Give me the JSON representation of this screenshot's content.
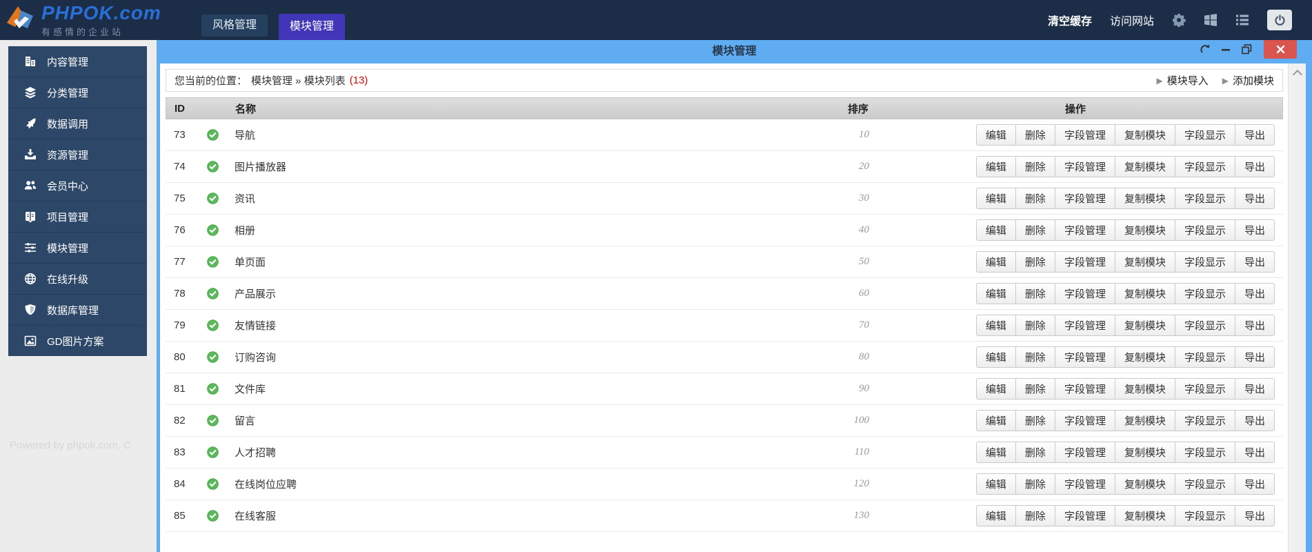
{
  "colors": {
    "header_bg": "#1c2e47",
    "accent_blue": "#60acf3",
    "active_tab_purple": "#4136b8",
    "sidebar_bg": "#2c4767",
    "close_red": "#d95550",
    "status_green": "#5cb85c",
    "count_red": "#e60000"
  },
  "header": {
    "logo": {
      "title": "PHPOK.com",
      "tagline": "有感情的企业站"
    },
    "tabs": [
      {
        "label": "风格管理"
      },
      {
        "label": "模块管理"
      }
    ],
    "active_tab_index": 1,
    "clear_cache": "清空缓存",
    "visit_site": "访问网站",
    "icons": [
      "gear-icon",
      "windows-icon",
      "list-icon",
      "power-icon"
    ]
  },
  "sidebar": {
    "items": [
      {
        "id": "content",
        "icon": "building-icon",
        "label": "内容管理"
      },
      {
        "id": "category",
        "icon": "layers-icon",
        "label": "分类管理"
      },
      {
        "id": "data-call",
        "icon": "rocket-icon",
        "label": "数据调用"
      },
      {
        "id": "resource",
        "icon": "download-tray-icon",
        "label": "资源管理"
      },
      {
        "id": "member",
        "icon": "users-icon",
        "label": "会员中心"
      },
      {
        "id": "project",
        "icon": "book-icon",
        "label": "项目管理"
      },
      {
        "id": "module",
        "icon": "sliders-icon",
        "label": "模块管理"
      },
      {
        "id": "upgrade",
        "icon": "globe-icon",
        "label": "在线升级"
      },
      {
        "id": "database",
        "icon": "shield-icon",
        "label": "数据库管理"
      },
      {
        "id": "gd-image",
        "icon": "image-icon",
        "label": "GD图片方案"
      }
    ],
    "footer": "Powered by phpok.com, C"
  },
  "panel": {
    "title": "模块管理",
    "breadcrumb": {
      "prefix": "您当前的位置：",
      "path": "模块管理 » 模块列表",
      "count": "(13)"
    },
    "toolbar": {
      "import_label": "模块导入",
      "add_label": "添加模块"
    },
    "table": {
      "headers": {
        "id": "ID",
        "name": "名称",
        "sort": "排序",
        "ops": "操作"
      },
      "row_actions": [
        "编辑",
        "删除",
        "字段管理",
        "复制模块",
        "字段显示",
        "导出"
      ],
      "rows": [
        {
          "id": "73",
          "name": "导航",
          "sort": "10"
        },
        {
          "id": "74",
          "name": "图片播放器",
          "sort": "20"
        },
        {
          "id": "75",
          "name": "资讯",
          "sort": "30"
        },
        {
          "id": "76",
          "name": "相册",
          "sort": "40"
        },
        {
          "id": "77",
          "name": "单页面",
          "sort": "50"
        },
        {
          "id": "78",
          "name": "产品展示",
          "sort": "60"
        },
        {
          "id": "79",
          "name": "友情链接",
          "sort": "70"
        },
        {
          "id": "80",
          "name": "订购咨询",
          "sort": "80"
        },
        {
          "id": "81",
          "name": "文件库",
          "sort": "90"
        },
        {
          "id": "82",
          "name": "留言",
          "sort": "100"
        },
        {
          "id": "83",
          "name": "人才招聘",
          "sort": "110"
        },
        {
          "id": "84",
          "name": "在线岗位应聘",
          "sort": "120"
        },
        {
          "id": "85",
          "name": "在线客服",
          "sort": "130"
        }
      ]
    }
  }
}
